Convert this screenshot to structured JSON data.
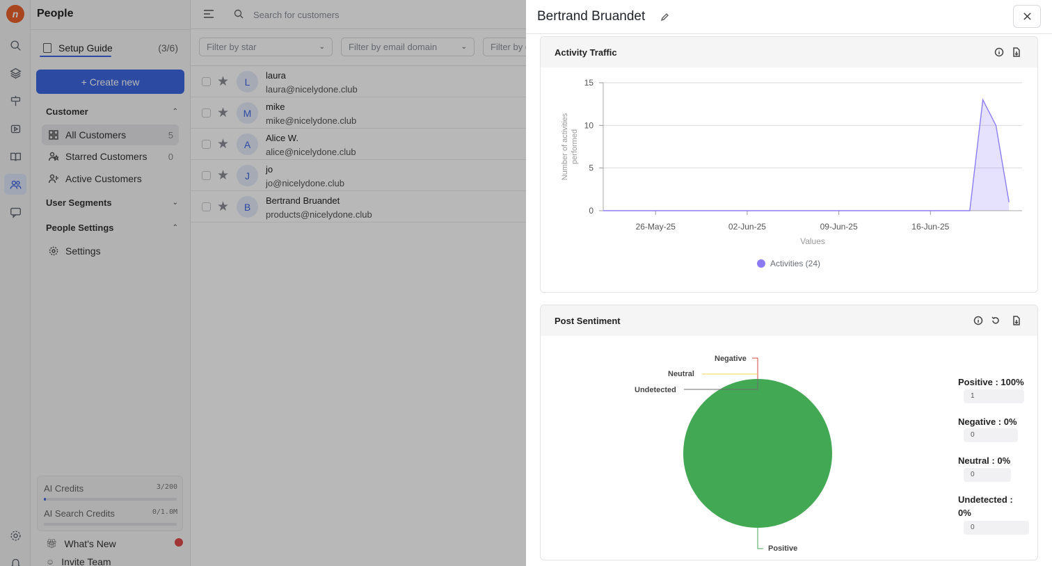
{
  "app": {
    "section_title": "People"
  },
  "sidebar": {
    "setup_guide": {
      "label": "Setup Guide",
      "count": "(3/6)"
    },
    "create_button": "+ Create new",
    "customer_section": "Customer",
    "items": [
      {
        "label": "All Customers",
        "count": "5",
        "icon": "grid-icon"
      },
      {
        "label": "Starred Customers",
        "count": "0",
        "icon": "star-user-icon"
      },
      {
        "label": "Active Customers",
        "count": "",
        "icon": "active-user-icon"
      }
    ],
    "user_segments": "User Segments",
    "people_settings": "People Settings",
    "settings": "Settings",
    "credits": [
      {
        "label": "AI Credits",
        "value": "3/200",
        "fraction": 0.015
      },
      {
        "label": "AI Search Credits",
        "value": "0/1.0M",
        "fraction": 0
      }
    ],
    "whats_new": "What's New",
    "invite_team": "Invite Team"
  },
  "main": {
    "search_placeholder": "Search for customers",
    "filters": [
      "Filter by star",
      "Filter by email domain",
      "Filter by c"
    ],
    "customers": [
      {
        "initial": "L",
        "name": "laura",
        "email": "laura@nicelydone.club"
      },
      {
        "initial": "M",
        "name": "mike",
        "email": "mike@nicelydone.club"
      },
      {
        "initial": "A",
        "name": "Alice W.",
        "email": "alice@nicelydone.club"
      },
      {
        "initial": "J",
        "name": "jo",
        "email": "jo@nicelydone.club"
      },
      {
        "initial": "B",
        "name": "Bertrand Bruandet",
        "email": "products@nicelydone.club"
      }
    ]
  },
  "panel": {
    "title": "Bertrand Bruandet",
    "activity": {
      "title": "Activity Traffic"
    },
    "sentiment": {
      "title": "Post Sentiment",
      "items": [
        {
          "label": "Positive : 100%",
          "value": "1"
        },
        {
          "label": "Negative : 0%",
          "value": "0"
        },
        {
          "label": "Neutral : 0%",
          "value": "0"
        },
        {
          "label": "Undetected :",
          "label2": "0%",
          "value": "0"
        }
      ],
      "pie_labels": {
        "negative": "Negative",
        "neutral": "Neutral",
        "undetected": "Undetected",
        "positive": "Positive"
      }
    }
  },
  "chart_data": [
    {
      "type": "area",
      "title": "Activity Traffic",
      "xlabel": "Values",
      "ylabel": "Number of activities performed",
      "ylim": [
        0,
        15
      ],
      "yticks": [
        "0",
        "5",
        "10",
        "15"
      ],
      "xticks": [
        "26-May-25",
        "02-Jun-25",
        "09-Jun-25",
        "16-Jun-25"
      ],
      "x": [
        "22-May-25",
        "19-Jun-25",
        "20-Jun-25",
        "21-Jun-25",
        "22-Jun-25"
      ],
      "series": [
        {
          "name": "Activities (24)",
          "values": [
            0,
            0,
            13,
            10,
            1
          ],
          "color": "#8b7cf6"
        }
      ],
      "grid": true,
      "legend": "bottom"
    },
    {
      "type": "pie",
      "title": "Post Sentiment",
      "categories": [
        "Positive",
        "Negative",
        "Neutral",
        "Undetected"
      ],
      "values": [
        100,
        0,
        0,
        0
      ],
      "colors": [
        "#43a853",
        "#d8453e",
        "#e9d84a",
        "#6a6e74"
      ]
    }
  ]
}
